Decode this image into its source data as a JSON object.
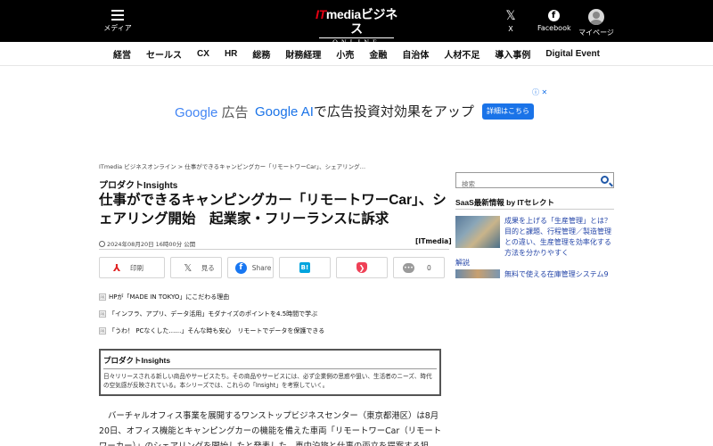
{
  "header": {
    "menu_label": "メディア",
    "logo_line1_brand": "IT",
    "logo_line1_rest": "mediaビジネス",
    "logo_line2": "ONLINE",
    "x_label": "X",
    "x_glyph": "𝕏",
    "facebook_label": "Facebook",
    "facebook_glyph": "f",
    "mypage_label": "マイページ"
  },
  "nav": {
    "items": [
      "経営",
      "セールス",
      "CX",
      "HR",
      "総務",
      "財務経理",
      "小売",
      "金融",
      "自治体",
      "人材不足",
      "導入事例",
      "Digital Event"
    ]
  },
  "ad": {
    "google": "Google",
    "google_suffix": "広告",
    "headline_blue": "Google AI",
    "headline_rest": "で広告投資対効果をアップ",
    "cta": "詳細はこちら",
    "icons": "ⓘ ✕"
  },
  "breadcrumb": "ITmedia ビジネスオンライン > 仕事ができるキャンピングカー「リモートワーCar」、シェアリング…",
  "article": {
    "section": "プロダクトInsights",
    "title": "仕事ができるキャンピングカー「リモートワーCar」、シェアリング開始　起業家・フリーランスに訴求",
    "date": "2024年08月20日 16時00分 公開",
    "source": "[ITmedia]",
    "share": {
      "print": "印刷",
      "print_glyph": "⅄",
      "x": "見る",
      "x_glyph": "𝕏",
      "facebook": "Share",
      "facebook_glyph": "f",
      "hatena_glyph": "B!",
      "pocket_glyph": "❯",
      "comment_glyph": "•••",
      "comments": "0"
    },
    "related_tag": "PR",
    "related": [
      "HPが「MADE IN TOKYO」にこだわる理由",
      "「インフラ、アプリ、データ活用」モダナイズのポイントを4.5時間で学ぶ",
      "「うわ！ PCなくした……」そんな時も安心　リモートでデータを保護できる"
    ],
    "insights_title": "プロダクトInsights",
    "insights_desc": "日々リリースされる新しい商品やサービスたち。その商品やサービスには、必ず企業側の思惑や狙い、生活者のニーズ、時代の空気感が反映されている。本シリーズでは、これらの「Insight」を考察していく。",
    "body": "バーチャルオフィス事業を展開するワンストップビジネスセンター（東京都港区）は8月20日、オフィス機能とキャンピングカーの機能を備えた車両「リモートワーCar（リモートワーカー）」のシェアリングを開始したと発表した。車中泊旅と仕事の両立を提案する狙"
  },
  "sidebar": {
    "search_placeholder": "検索",
    "saas_heading": "SaaS最新情報 by ITセレクト",
    "items": [
      "成果を上げる「生産管理」とは？　目的と課題、行程管理／製造管理との違い、生産管理を効率化する方法を分かりやすく",
      "解説",
      "無料で使える在庫管理システム9"
    ]
  }
}
